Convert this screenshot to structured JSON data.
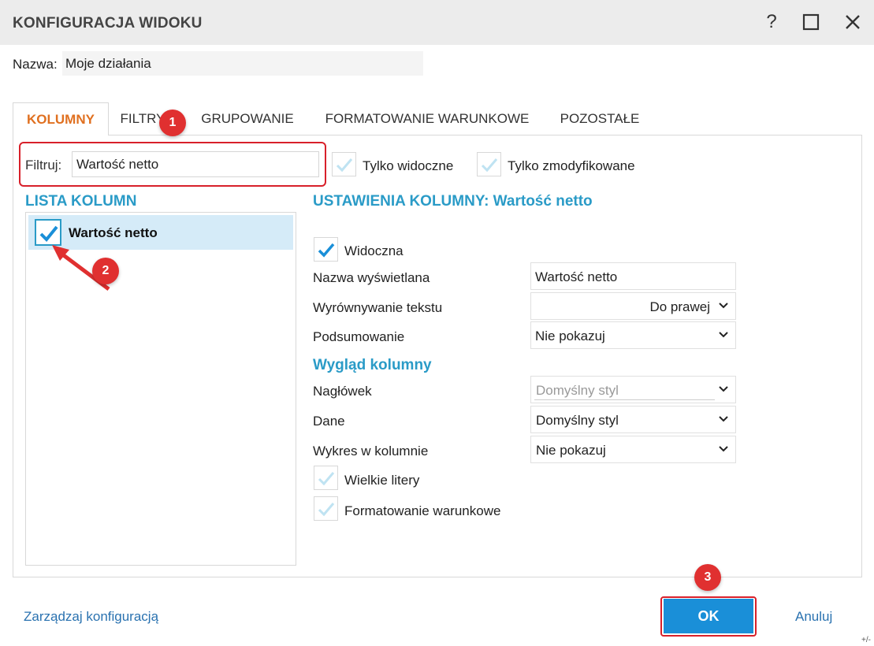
{
  "window": {
    "title": "KONFIGURACJA WIDOKU",
    "help_symbol": "?"
  },
  "name_row": {
    "label": "Nazwa:",
    "value": "Moje działania"
  },
  "tabs": [
    {
      "label": "KOLUMNY",
      "active": true
    },
    {
      "label": "FILTRY",
      "active": false
    },
    {
      "label": "GRUPOWANIE",
      "active": false
    },
    {
      "label": "FORMATOWANIE WARUNKOWE",
      "active": false
    },
    {
      "label": "POZOSTAŁE",
      "active": false
    }
  ],
  "filter": {
    "label": "Filtruj:",
    "value": "Wartość netto",
    "only_visible": {
      "label": "Tylko widoczne",
      "checked": false
    },
    "only_modified": {
      "label": "Tylko zmodyfikowane",
      "checked": false
    }
  },
  "column_list": {
    "title": "LISTA KOLUMN",
    "items": [
      {
        "label": "Wartość netto",
        "checked": true,
        "selected": true
      }
    ]
  },
  "column_settings": {
    "title": "USTAWIENIA KOLUMNY: Wartość netto",
    "visible": {
      "label": "Widoczna",
      "checked": true
    },
    "display_name": {
      "label": "Nazwa wyświetlana",
      "value": "Wartość netto"
    },
    "text_align": {
      "label": "Wyrównywanie tekstu",
      "value": "Do prawej"
    },
    "summary": {
      "label": "Podsumowanie",
      "value": "Nie pokazuj"
    },
    "appearance_title": "Wygląd kolumny",
    "header": {
      "label": "Nagłówek",
      "value": "Domyślny styl"
    },
    "data": {
      "label": "Dane",
      "value": "Domyślny styl"
    },
    "chart": {
      "label": "Wykres w kolumnie",
      "value": "Nie pokazuj"
    },
    "uppercase": {
      "label": "Wielkie litery",
      "checked": false
    },
    "conditional": {
      "label": "Formatowanie warunkowe",
      "checked": false
    }
  },
  "annotations": {
    "badge1": "1",
    "badge2": "2",
    "badge3": "3"
  },
  "footer": {
    "manage_link": "Zarządzaj konfiguracją",
    "ok_label": "OK",
    "cancel_label": "Anuluj",
    "resize_label": "+/-"
  },
  "colors": {
    "accent_blue": "#2a9bc7",
    "active_tab": "#e07020",
    "annotation_red": "#d8202a",
    "ok_button": "#1a8fd8"
  }
}
